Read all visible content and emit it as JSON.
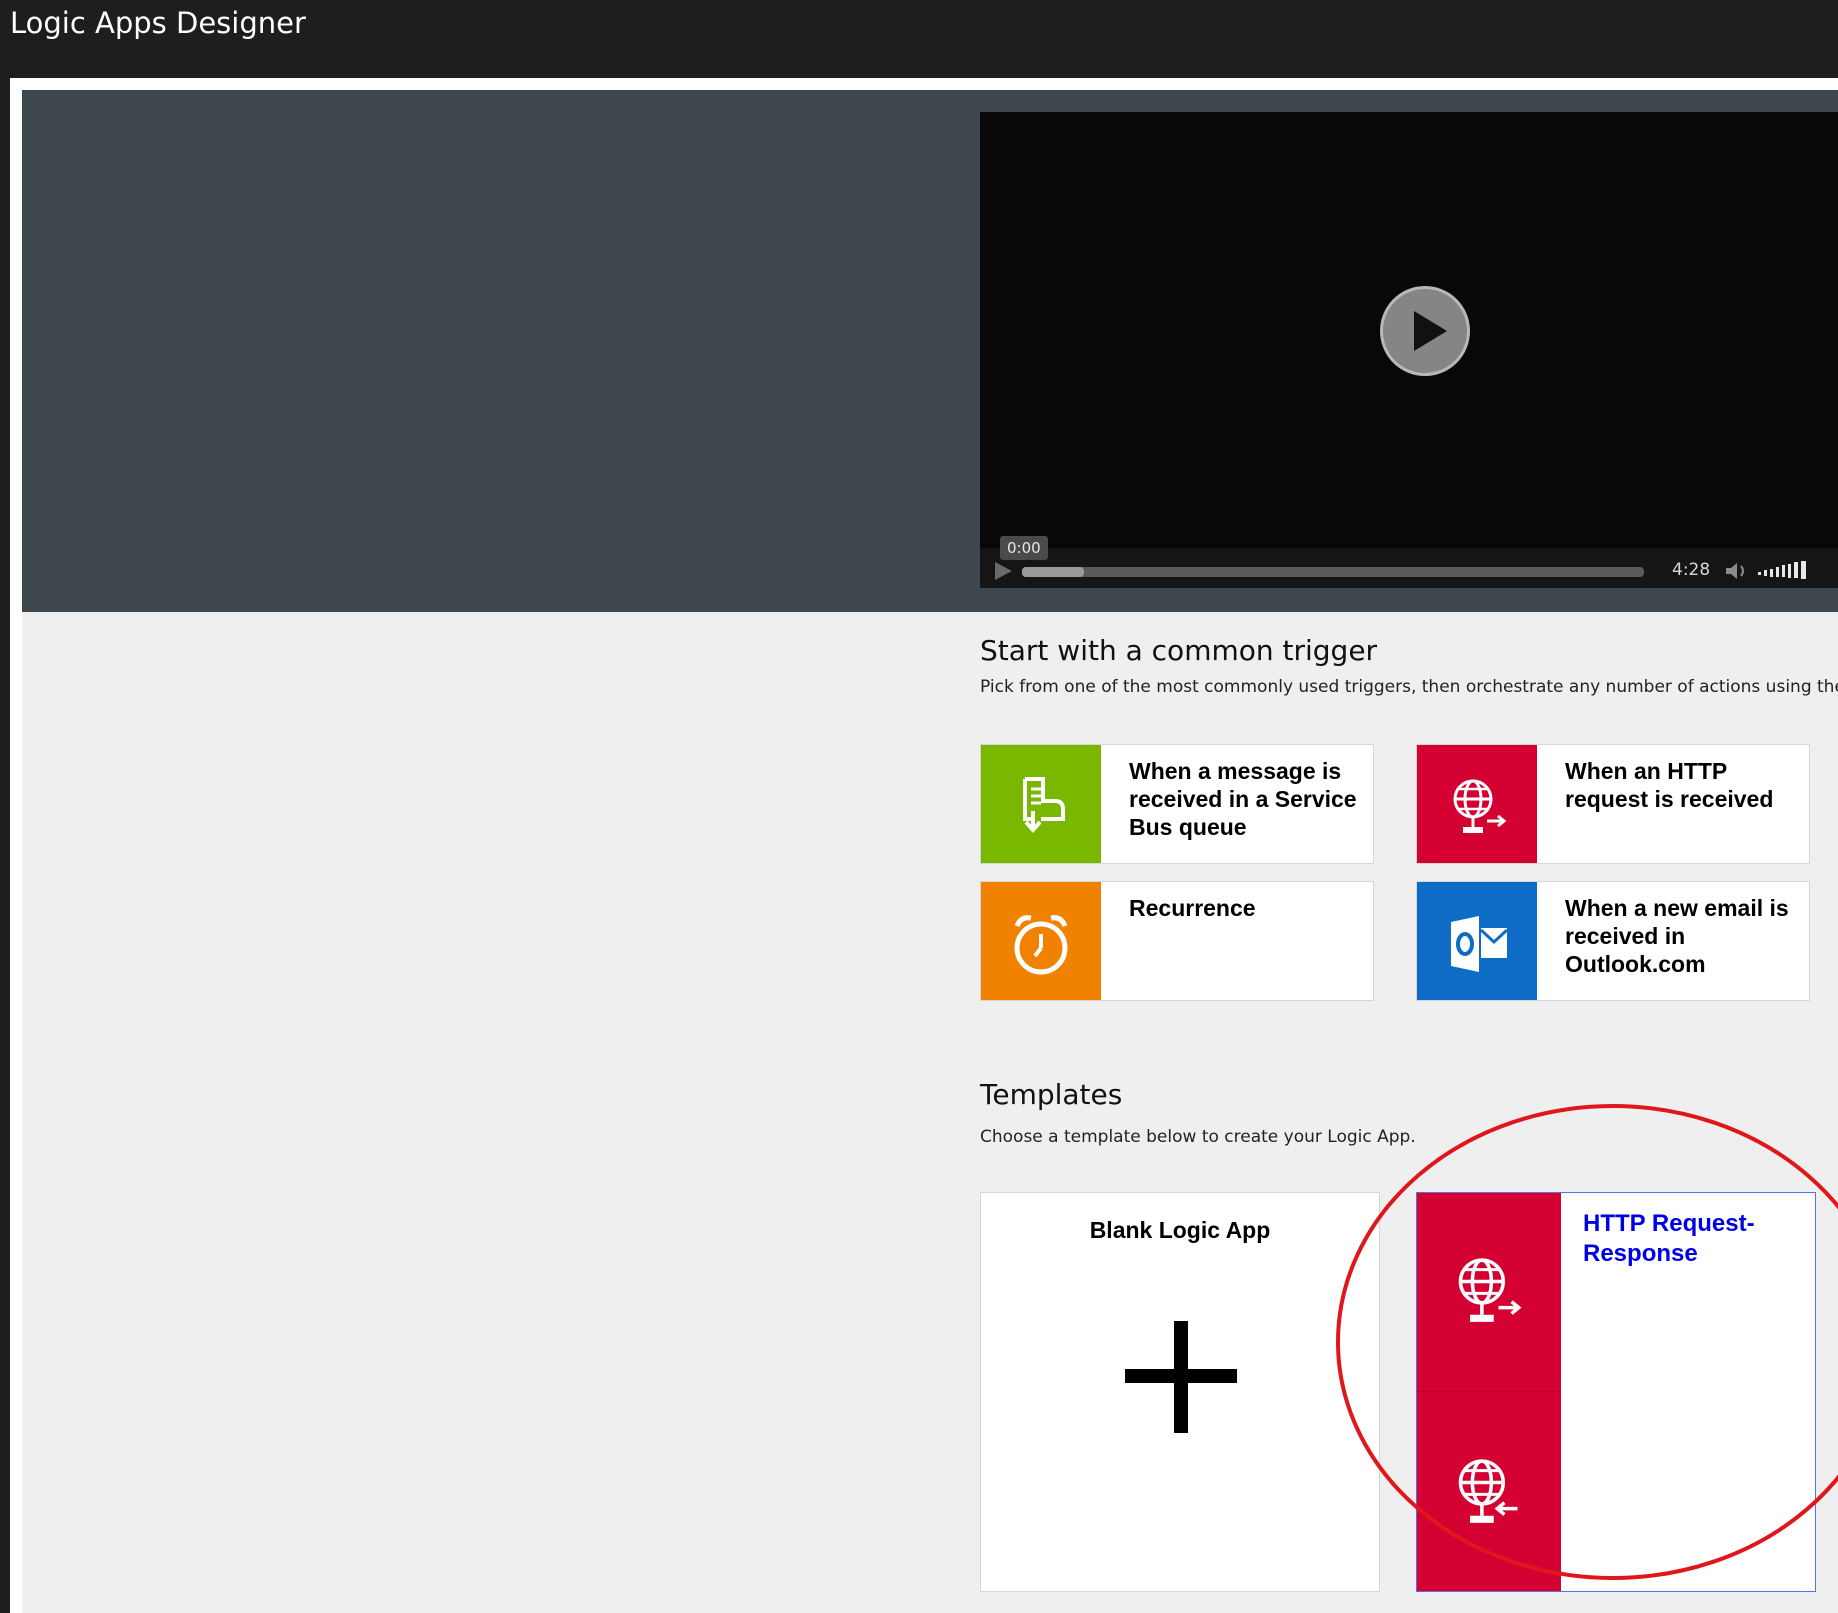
{
  "app": {
    "title": "Logic Apps Designer"
  },
  "video": {
    "current_time": "0:00",
    "duration": "4:28",
    "progress": 0.1
  },
  "triggers": {
    "title": "Start with a common trigger",
    "subtitle": "Pick from one of the most commonly used triggers, then orchestrate any number of actions using the rich co",
    "items": [
      {
        "label": "When a message is received in a Service Bus queue",
        "color": "#7ab800",
        "icon": "service-bus-icon"
      },
      {
        "label": "When an HTTP request is received",
        "color": "#d50032",
        "icon": "http-request-icon"
      },
      {
        "label": "Recurrence",
        "color": "#f08200",
        "icon": "alarm-clock-icon"
      },
      {
        "label": "When a new email is received in Outlook.com",
        "color": "#0f6cc6",
        "icon": "outlook-icon"
      }
    ]
  },
  "templates": {
    "title": "Templates",
    "subtitle": "Choose a template below to create your Logic App.",
    "items": [
      {
        "label": "Blank Logic App",
        "icon": "plus-icon"
      },
      {
        "label": "HTTP Request-Response",
        "color": "#d50032",
        "icon": "http-request-response-icon"
      }
    ]
  },
  "colors": {
    "hero_bg": "#3e464e",
    "content_bg": "#efefef",
    "annotation_circle": "#e0161b",
    "link_blue": "#0000e6"
  }
}
